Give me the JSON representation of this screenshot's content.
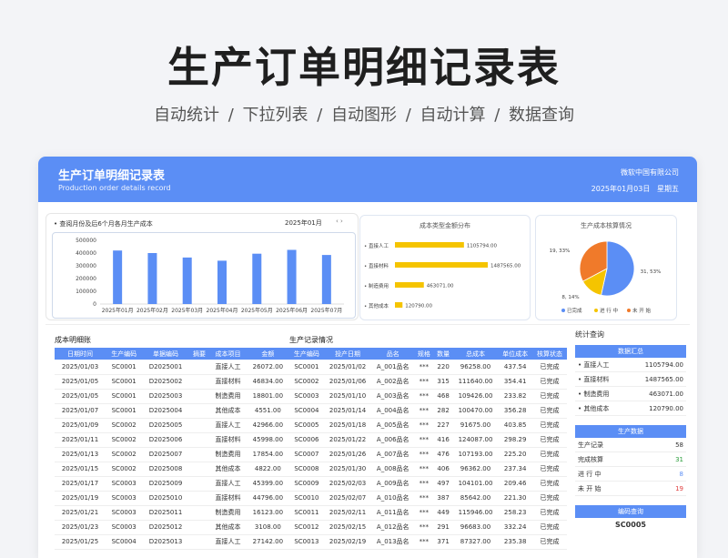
{
  "hero": {
    "title": "生产订单明细记录表",
    "subtitle": "自动统计 / 下拉列表 / 自动图形 / 自动计算 / 数据查询"
  },
  "header": {
    "title": "生产订单明细记录表",
    "title_en": "Production order details record",
    "company": "微软中国有限公司",
    "date": "2025年01月03日",
    "weekday": "星期五"
  },
  "monthly": {
    "label": "• 查阅月份及后6个月各月生产成本",
    "month": "2025年01月",
    "arrows": "‹ ›"
  },
  "chart_data": [
    {
      "type": "bar",
      "categories": [
        "2025年01月",
        "2025年02月",
        "2025年03月",
        "2025年04月",
        "2025年05月",
        "2025年06月",
        "2025年07月"
      ],
      "values": [
        420000,
        400000,
        365000,
        340000,
        395000,
        425000,
        385000
      ],
      "title": "",
      "ylim": [
        0,
        500000
      ],
      "yticks": [
        "0",
        "100000",
        "200000",
        "300000",
        "400000",
        "500000"
      ],
      "color": "#5b8ef5"
    },
    {
      "type": "bar",
      "orientation": "horizontal",
      "title": "成本类型金额分布",
      "categories": [
        "直接人工",
        "直接材料",
        "制造费用",
        "其他成本"
      ],
      "values": [
        1105794.0,
        1487565.0,
        463071.0,
        120790.0
      ],
      "labels": [
        "1105794.00",
        "1487565.00",
        "463071.00",
        "120790.00"
      ],
      "color": "#f5c400"
    },
    {
      "type": "pie",
      "title": "生产成本核算情况",
      "categories": [
        "已完成",
        "进 行 中",
        "未 开 始"
      ],
      "values": [
        31,
        8,
        19
      ],
      "labels": [
        "31, 53%",
        "8, 14%",
        "19, 33%"
      ],
      "colors": [
        "#5b8ef5",
        "#f5c400",
        "#f07a2a"
      ]
    }
  ],
  "cost_table": {
    "title": "成本明细账",
    "headers": [
      "日期时间",
      "生产编码",
      "单据编码",
      "摘要",
      "成本项目",
      "金额"
    ],
    "rows": [
      [
        "2025/01/03",
        "SC0001",
        "D2025001",
        "",
        "直接人工",
        "26072.00"
      ],
      [
        "2025/01/05",
        "SC0001",
        "D2025002",
        "",
        "直接材料",
        "46834.00"
      ],
      [
        "2025/01/05",
        "SC0001",
        "D2025003",
        "",
        "制造费用",
        "18801.00"
      ],
      [
        "2025/01/07",
        "SC0001",
        "D2025004",
        "",
        "其他成本",
        "4551.00"
      ],
      [
        "2025/01/09",
        "SC0002",
        "D2025005",
        "",
        "直接人工",
        "42966.00"
      ],
      [
        "2025/01/11",
        "SC0002",
        "D2025006",
        "",
        "直接材料",
        "45998.00"
      ],
      [
        "2025/01/13",
        "SC0002",
        "D2025007",
        "",
        "制造费用",
        "17854.00"
      ],
      [
        "2025/01/15",
        "SC0002",
        "D2025008",
        "",
        "其他成本",
        "4822.00"
      ],
      [
        "2025/01/17",
        "SC0003",
        "D2025009",
        "",
        "直接人工",
        "45399.00"
      ],
      [
        "2025/01/19",
        "SC0003",
        "D2025010",
        "",
        "直接材料",
        "44796.00"
      ],
      [
        "2025/01/21",
        "SC0003",
        "D2025011",
        "",
        "制造费用",
        "16123.00"
      ],
      [
        "2025/01/23",
        "SC0003",
        "D2025012",
        "",
        "其他成本",
        "3108.00"
      ],
      [
        "2025/01/25",
        "SC0004",
        "D2025013",
        "",
        "直接人工",
        "27142.00"
      ]
    ]
  },
  "prod_table": {
    "title": "生产记录情况",
    "headers": [
      "生产编码",
      "投产日期",
      "品名",
      "规格",
      "数量",
      "总成本",
      "单位成本",
      "核算状态"
    ],
    "rows": [
      [
        "SC0001",
        "2025/01/02",
        "A_001品名",
        "***",
        "220",
        "96258.00",
        "437.54",
        "已完成"
      ],
      [
        "SC0002",
        "2025/01/06",
        "A_002品名",
        "***",
        "315",
        "111640.00",
        "354.41",
        "已完成"
      ],
      [
        "SC0003",
        "2025/01/10",
        "A_003品名",
        "***",
        "468",
        "109426.00",
        "233.82",
        "已完成"
      ],
      [
        "SC0004",
        "2025/01/14",
        "A_004品名",
        "***",
        "282",
        "100470.00",
        "356.28",
        "已完成"
      ],
      [
        "SC0005",
        "2025/01/18",
        "A_005品名",
        "***",
        "227",
        "91675.00",
        "403.85",
        "已完成"
      ],
      [
        "SC0006",
        "2025/01/22",
        "A_006品名",
        "***",
        "416",
        "124087.00",
        "298.29",
        "已完成"
      ],
      [
        "SC0007",
        "2025/01/26",
        "A_007品名",
        "***",
        "476",
        "107193.00",
        "225.20",
        "已完成"
      ],
      [
        "SC0008",
        "2025/01/30",
        "A_008品名",
        "***",
        "406",
        "96362.00",
        "237.34",
        "已完成"
      ],
      [
        "SC0009",
        "2025/02/03",
        "A_009品名",
        "***",
        "497",
        "104101.00",
        "209.46",
        "已完成"
      ],
      [
        "SC0010",
        "2025/02/07",
        "A_010品名",
        "***",
        "387",
        "85642.00",
        "221.30",
        "已完成"
      ],
      [
        "SC0011",
        "2025/02/11",
        "A_011品名",
        "***",
        "449",
        "115946.00",
        "258.23",
        "已完成"
      ],
      [
        "SC0012",
        "2025/02/15",
        "A_012品名",
        "***",
        "291",
        "96683.00",
        "332.24",
        "已完成"
      ],
      [
        "SC0013",
        "2025/02/19",
        "A_013品名",
        "***",
        "371",
        "87327.00",
        "235.38",
        "已完成"
      ]
    ]
  },
  "side": {
    "title": "统计查询",
    "summary_head": "数据汇总",
    "summary": [
      [
        "• 直接人工",
        "1105794.00"
      ],
      [
        "• 直接材料",
        "1487565.00"
      ],
      [
        "• 制造费用",
        "463071.00"
      ],
      [
        "• 其他成本",
        "120790.00"
      ]
    ],
    "prod_head": "生产数据",
    "prod": [
      [
        "生产记录",
        "58"
      ],
      [
        "完成核算",
        "31"
      ],
      [
        "进 行 中",
        "8"
      ],
      [
        "未 开 始",
        "19"
      ]
    ],
    "query_head": "编码查询",
    "query_code": "SC0005"
  }
}
